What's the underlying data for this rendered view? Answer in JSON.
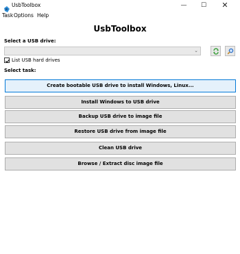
{
  "window": {
    "title": "UsbToolbox",
    "minimize": "—",
    "maximize": "☐",
    "close": "✕"
  },
  "menu": [
    "Task",
    "Options",
    "Help"
  ],
  "app_title": "UsbToolbox",
  "drive": {
    "label": "Select a USB drive:",
    "selected_value": "",
    "chevron": "⌄",
    "list_hard_drives": {
      "label": "List USB hard drives",
      "checked": true
    }
  },
  "task_label": "Select task:",
  "tasks": [
    "Create bootable USB drive to install Windows, Linux...",
    "Install Windows to USB drive",
    "Backup USB drive to image file",
    "Restore USB drive from image file",
    "Clean USB drive",
    "Browse / Extract disc image file"
  ],
  "colors": {
    "focus_border": "#0078d7",
    "button_bg": "#e1e1e1",
    "refresh_green": "#3aa03a",
    "search_blue": "#2a6fc9"
  }
}
